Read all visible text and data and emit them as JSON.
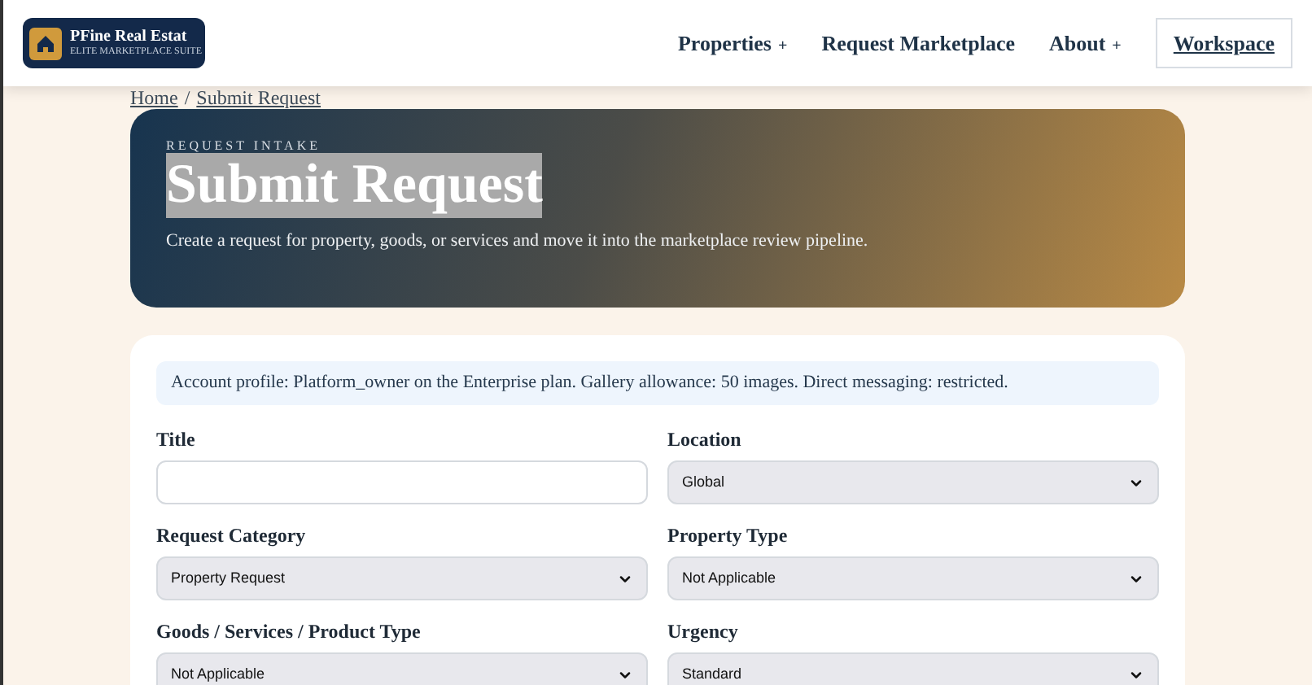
{
  "header": {
    "logo": {
      "name": "PFine Real Estat",
      "tagline": "ELITE MARKETPLACE SUITE"
    },
    "nav": [
      {
        "label": "Properties",
        "kind": "dropdown",
        "suffix": "+"
      },
      {
        "label": "Request Marketplace",
        "kind": "link"
      },
      {
        "label": "About",
        "kind": "dropdown",
        "suffix": "+"
      },
      {
        "label": "Workspace",
        "kind": "outlined"
      }
    ]
  },
  "breadcrumb": [
    {
      "label": "Home"
    },
    {
      "label": "Submit Request"
    }
  ],
  "breadcrumb_separator": "/",
  "hero": {
    "eyebrow": "REQUEST INTAKE",
    "title": "Submit Request",
    "title_selected": true,
    "description": "Create a request for property, goods, or services and move it into the marketplace review pipeline."
  },
  "form": {
    "notice": "Account profile: Platform_owner on the Enterprise plan. Gallery allowance: 50 images. Direct messaging: restricted.",
    "fields": [
      {
        "label": "Title",
        "kind": "text"
      },
      {
        "label": "Location",
        "kind": "select",
        "value": "Global"
      },
      {
        "label": "Request Category",
        "kind": "select",
        "value": "Property Request"
      },
      {
        "label": "Property Type",
        "kind": "select",
        "value": "Not Applicable"
      },
      {
        "label": "Goods / Services / Product Type",
        "kind": "select",
        "value": "Not Applicable"
      },
      {
        "label": "Urgency",
        "kind": "select",
        "value": "Standard"
      }
    ]
  }
}
